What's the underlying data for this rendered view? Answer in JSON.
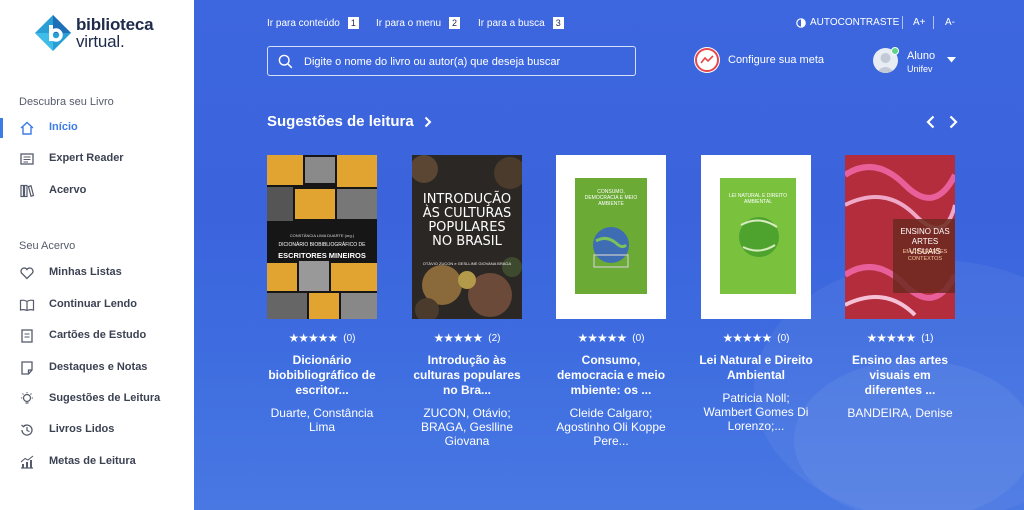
{
  "brand": {
    "line1": "biblioteca",
    "line2": "virtual."
  },
  "sidebar": {
    "section1": "Descubra seu Livro",
    "items1": [
      {
        "label": "Início",
        "icon": "home-icon"
      },
      {
        "label": "Expert Reader",
        "icon": "reader-icon"
      },
      {
        "label": "Acervo",
        "icon": "library-icon"
      }
    ],
    "section2": "Seu Acervo",
    "items2": [
      {
        "label": "Minhas Listas",
        "icon": "heart-icon"
      },
      {
        "label": "Continuar Lendo",
        "icon": "book-open-icon"
      },
      {
        "label": "Cartões de Estudo",
        "icon": "card-icon"
      },
      {
        "label": "Destaques e Notas",
        "icon": "note-icon"
      },
      {
        "label": "Sugestões de Leitura",
        "icon": "lightbulb-icon"
      },
      {
        "label": "Livros Lidos",
        "icon": "history-icon"
      },
      {
        "label": "Metas de Leitura",
        "icon": "chart-icon"
      }
    ]
  },
  "skiplinks": [
    {
      "label": "Ir para conteúdo",
      "key": "1"
    },
    {
      "label": "Ir para o menu",
      "key": "2"
    },
    {
      "label": "Ir para a busca",
      "key": "3"
    }
  ],
  "accessibility": {
    "contrast": "AUTOCONTRASTE",
    "font_up": "A+",
    "font_down": "A-"
  },
  "search": {
    "placeholder": "Digite o nome do livro ou autor(a) que deseja buscar"
  },
  "meta": {
    "label": "Configure sua meta"
  },
  "user": {
    "name": "Aluno",
    "institution": "Unifev"
  },
  "suggestions": {
    "heading": "Sugestões de leitura",
    "books": [
      {
        "rating": "★★★★★",
        "count": "(0)",
        "title": "Dicionário biobibliográfico de escritor...",
        "author": "Duarte, Constância Lima",
        "cover": {
          "title": "ESCRITORES MINEIROS",
          "subtitle": "DICIONÁRIO BIOBIBLIOGRÁFICO DE",
          "editor": "CONSTÂNCIA LIMA DUARTE (org.)"
        }
      },
      {
        "rating": "★★★★★",
        "count": "(2)",
        "title": "Introdução às culturas populares no Bra...",
        "author": "ZUCON, Otávio; BRAGA, Geslline Giovana",
        "cover": {
          "title": "INTRODUÇÃO ÀS CULTURAS POPULARES NO BRASIL",
          "editor": "OTÁVIO ZUCON e GESLLINE GIOVANA BRAGA"
        }
      },
      {
        "rating": "★★★★★",
        "count": "(0)",
        "title": "Consumo, democracia e meio mbiente: os ...",
        "author": "Cleide Calgaro; Agostinho Oli Koppe Pere...",
        "cover": {
          "title": "CONSUMO, DEMOCRACIA E MEIO AMBIENTE"
        }
      },
      {
        "rating": "★★★★★",
        "count": "(0)",
        "title": "Lei Natural e Direito Ambiental",
        "author": "Patricia Noll; Wambert Gomes Di Lorenzo;...",
        "cover": {
          "title": "LEI NATURAL E DIREITO AMBIENTAL"
        }
      },
      {
        "rating": "★★★★★",
        "count": "(1)",
        "title": "Ensino das artes visuais em diferentes ...",
        "author": "BANDEIRA, Denise",
        "cover": {
          "title": "ENSINO DAS ARTES VISUAIS",
          "subtitle": "EM DIFERENTES CONTEXTOS"
        }
      }
    ]
  },
  "colors": {
    "accent": "#3d7be6",
    "main_bg": "#3d67df",
    "brand_dark": "#1e2b4b",
    "meta_ring": "#e5484d"
  }
}
